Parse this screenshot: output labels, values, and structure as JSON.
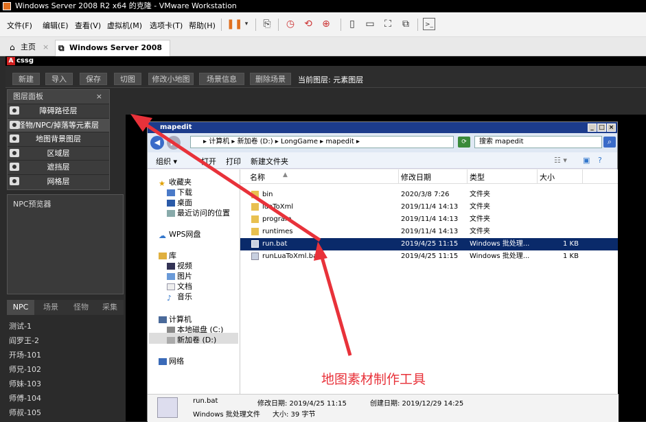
{
  "window_title": "Windows Server 2008 R2 x64 的克隆 - VMware Workstation",
  "menus": [
    "文件(F)",
    "编辑(E)",
    "查看(V)",
    "虚拟机(M)",
    "选项卡(T)",
    "帮助(H)"
  ],
  "tabs": [
    {
      "label": "主页"
    },
    {
      "label": "Windows Server 2008 R2 ..."
    }
  ],
  "game_title": "cssg",
  "toolbar_buttons": [
    "新建",
    "导入",
    "保存",
    "切图",
    "修改小地图",
    "场景信息",
    "删除场景"
  ],
  "current_layer": "当前图层: 元素图层",
  "layer_panel": {
    "title": "图层面板",
    "layers": [
      "障碍路径层",
      "怪物/NPC/掉落等元素层",
      "地图背景图层",
      "区域层",
      "遮挡层",
      "网格层"
    ]
  },
  "npc_preview": "NPC预览器",
  "npc_tabs": [
    "NPC",
    "场景",
    "怪物",
    "采集"
  ],
  "npc_list": [
    "测试-1",
    "阎罗王-2",
    "开场-101",
    "师兄-102",
    "师妹-103",
    "师傅-104",
    "师叔-105"
  ],
  "explorer": {
    "title": "mapedit",
    "address": "▸ 计算机 ▸ 新加卷 (D:) ▸ LongGame ▸ mapedit ▸",
    "search": "搜索 mapedit",
    "commands": [
      "组织 ▾",
      "打开",
      "打印",
      "新建文件夹"
    ],
    "nav_items": [
      "收藏夹",
      "下载",
      "桌面",
      "最近访问的位置",
      "WPS网盘",
      "库",
      "视频",
      "图片",
      "文档",
      "音乐",
      "计算机",
      "本地磁盘 (C:)",
      "新加卷 (D:)",
      "网络"
    ],
    "columns": [
      "名称",
      "修改日期",
      "类型",
      "大小"
    ],
    "files": [
      {
        "name": "bin",
        "date": "2020/3/8 7:26",
        "type": "文件夹",
        "size": ""
      },
      {
        "name": "luaToXml",
        "date": "2019/11/4 14:13",
        "type": "文件夹",
        "size": ""
      },
      {
        "name": "program",
        "date": "2019/11/4 14:13",
        "type": "文件夹",
        "size": ""
      },
      {
        "name": "runtimes",
        "date": "2019/11/4 14:13",
        "type": "文件夹",
        "size": ""
      },
      {
        "name": "run.bat",
        "date": "2019/4/25 11:15",
        "type": "Windows 批处理...",
        "size": "1 KB"
      },
      {
        "name": "runLuaToXml.bat",
        "date": "2019/4/25 11:15",
        "type": "Windows 批处理...",
        "size": "1 KB"
      }
    ],
    "details": {
      "name": "run.bat",
      "type": "Windows 批处理文件",
      "modified": "修改日期: 2019/4/25 11:15",
      "created": "创建日期: 2019/12/29 14:25",
      "size": "大小: 39 字节"
    }
  },
  "caption": "地图素材制作工具",
  "colors": {
    "arrow": "#e8323a",
    "selection": "#0a2a6a"
  }
}
